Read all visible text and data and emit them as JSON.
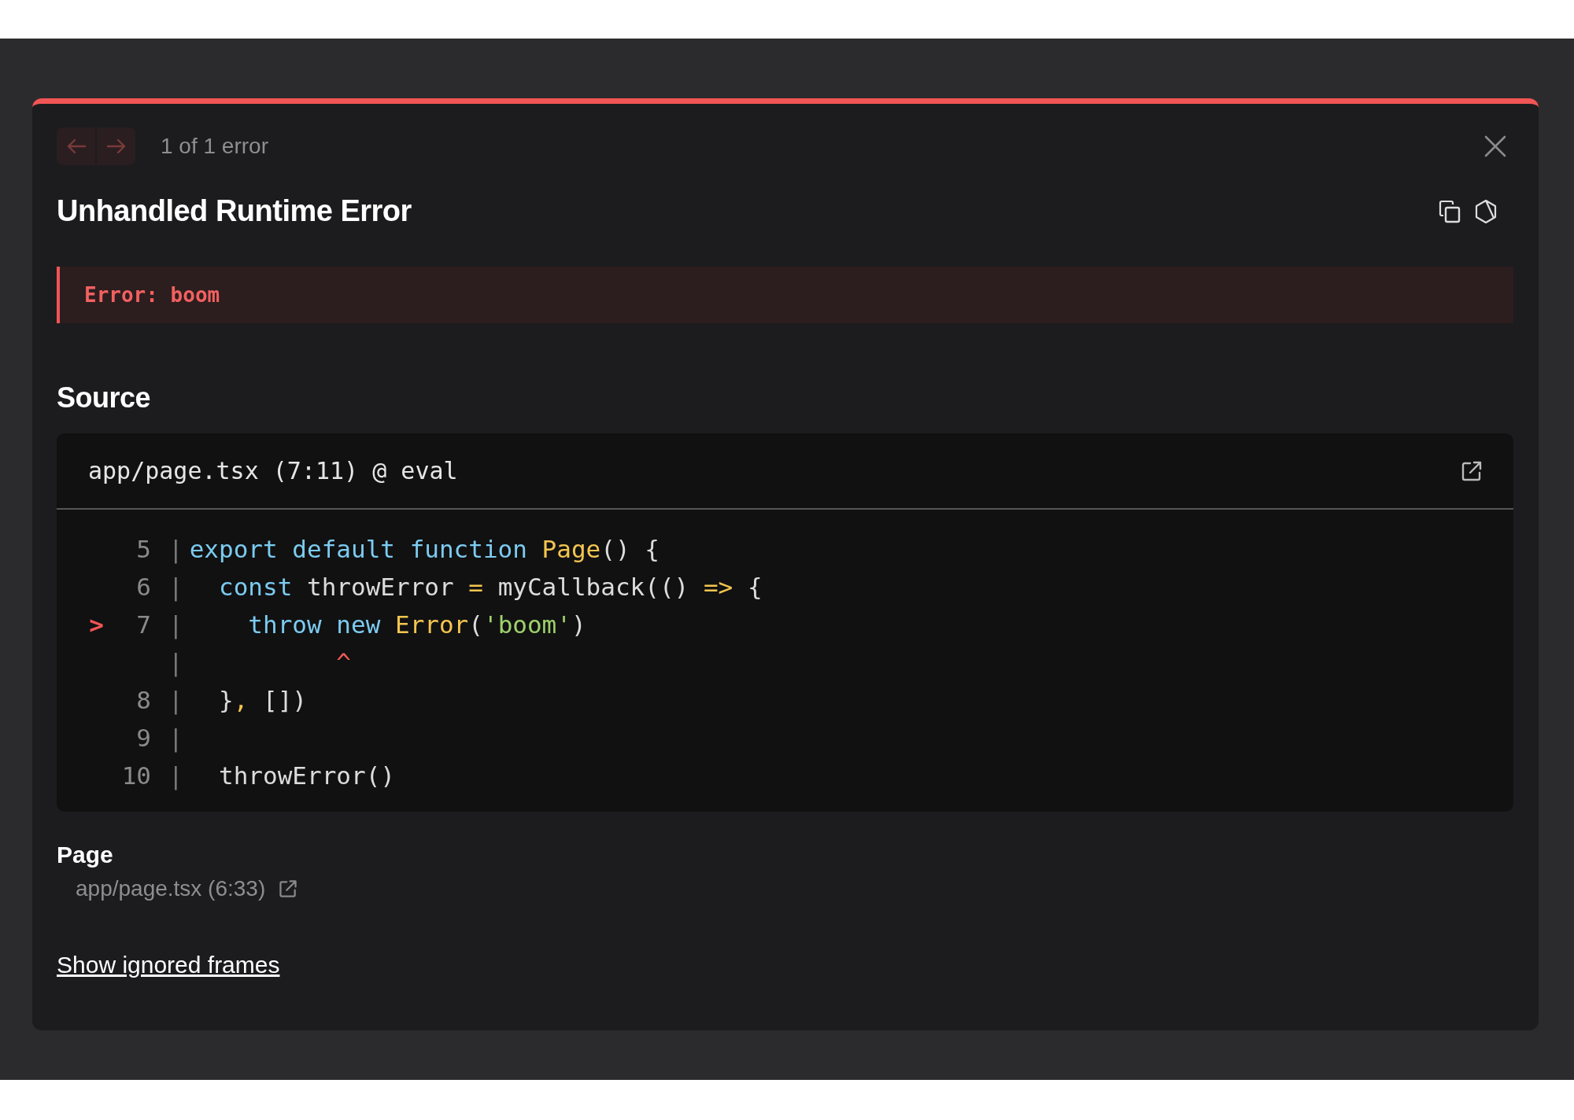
{
  "nav": {
    "buttons": [
      {
        "kind": "previous",
        "disabled": true
      },
      {
        "kind": "next",
        "disabled": true
      }
    ],
    "counter": "1 of 1 error"
  },
  "title": "Unhandled Runtime Error",
  "error_message": "Error: boom",
  "source": {
    "heading": "Source",
    "file": "app/page.tsx (7:11) @ eval",
    "lines": [
      {
        "number": "5",
        "gutter": "|",
        "tokens": [
          {
            "kind": "keyword",
            "text": "export default function "
          },
          {
            "kind": "name",
            "text": "Page"
          },
          {
            "kind": "plain",
            "text": "() {"
          }
        ]
      },
      {
        "number": "6",
        "gutter": "|",
        "tokens": [
          {
            "kind": "keyword",
            "text": "  const "
          },
          {
            "kind": "plain",
            "text": "throwError "
          },
          {
            "kind": "operator",
            "text": "="
          },
          {
            "kind": "plain",
            "text": " myCallback(() "
          },
          {
            "kind": "operator",
            "text": "=>"
          },
          {
            "kind": "plain",
            "text": " {"
          }
        ]
      },
      {
        "marker": ">",
        "number": "7",
        "gutter": "|",
        "tokens": [
          {
            "kind": "keyword",
            "text": "    throw new "
          },
          {
            "kind": "name",
            "text": "Error"
          },
          {
            "kind": "plain",
            "text": "("
          },
          {
            "kind": "string",
            "text": "'boom'"
          },
          {
            "kind": "plain",
            "text": ")"
          }
        ]
      },
      {
        "gutter": "|",
        "tokens": [
          {
            "kind": "caret",
            "text": "          ^"
          }
        ]
      },
      {
        "number": "8",
        "gutter": "|",
        "tokens": [
          {
            "kind": "plain",
            "text": "  }"
          },
          {
            "kind": "operator",
            "text": ","
          },
          {
            "kind": "plain",
            "text": " [])"
          }
        ]
      },
      {
        "number": "9",
        "gutter": "|"
      },
      {
        "number": "10",
        "gutter": "|",
        "tokens": [
          {
            "kind": "plain",
            "text": "  throwError()"
          }
        ]
      }
    ]
  },
  "frames": [
    {
      "name": "Page",
      "location": "app/page.tsx (6:33)"
    }
  ],
  "ignored_frames_link": "Show ignored frames"
}
